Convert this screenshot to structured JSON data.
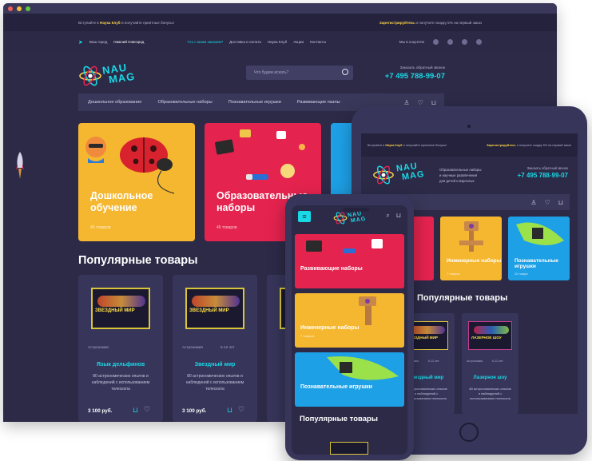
{
  "desktop": {
    "window_dots": [
      "#ee5d52",
      "#f5be33",
      "#5fc83d"
    ],
    "top_strip": {
      "left_prefix": "Вступайте в",
      "left_link": "Наука Клуб",
      "left_suffix": "и получайте приятные бонусы!",
      "right_link": "Зарегистрируйтесь",
      "right_suffix": "и получите скидку 5% на первый заказ"
    },
    "nav": {
      "city_label": "Ваш город",
      "city": "Нижний Новгород",
      "items": [
        "Что с моим заказом?",
        "Доставка и оплата",
        "Наука Клуб",
        "Акции",
        "Контакты"
      ],
      "social_label": "Мы в соцсетях"
    },
    "logo": {
      "line1": "NAU",
      "line2": "MAG"
    },
    "search_placeholder": "Что будем искать?",
    "callback_label": "Заказать обратный звонок",
    "phone": "+7 495 788-99-07",
    "menu": [
      "Дошкольное образование",
      "Образовательные наборы",
      "Познавательные игрушки",
      "Развивающие пазлы"
    ],
    "categories": [
      {
        "name": "Дошкольное обучение",
        "count": "45 товаров",
        "color": "#f5b730"
      },
      {
        "name": "Образовательные наборы",
        "count": "45 товаров",
        "color": "#e5234f"
      },
      {
        "name": "",
        "count": "",
        "color": "#1ea0e6"
      }
    ],
    "section_title": "Популярные товары",
    "products": [
      {
        "category": "Астрономия",
        "age": "",
        "name": "Язык дельфинов",
        "desc": "80 астрономических опытов и наблюдений с использованием телескопа",
        "price": "3 100 руб.",
        "image_text": "ЗВЕЗДНЫЙ МИР"
      },
      {
        "category": "Астрономия",
        "age": "6-12 лет",
        "name": "Звездный мир",
        "desc": "80 астрономических опытов и наблюдений с использованием телескопа",
        "price": "3 100 руб.",
        "image_text": "ЗВЕЗДНЫЙ МИР"
      },
      {
        "category": "",
        "age": "",
        "name": "",
        "desc": "",
        "price": "",
        "image_text": ""
      }
    ]
  },
  "tablet": {
    "top_strip": {
      "left_prefix": "Вступайте в",
      "left_link": "Наука Клуб",
      "left_suffix": "и получайте приятные бонусы!",
      "right_link": "Зарегистрируйтесь",
      "right_suffix": "и получите скидку 5% на первый заказ"
    },
    "tagline": [
      "Образовательные наборы",
      "и научные развлечения",
      "для детей и взрослых"
    ],
    "callback_label": "Заказать обратный звонок",
    "phone": "+7 495 788-99-07",
    "categories": [
      {
        "name": "",
        "count": "",
        "color": "#e5234f"
      },
      {
        "name": "Инженерные наборы",
        "count": "7 товаров",
        "color": "#f5b730"
      },
      {
        "name": "Познавательные игрушки",
        "count": "32 товара",
        "color": "#1ea0e6"
      }
    ],
    "section_title": "Популярные товары",
    "products": [
      {
        "category": "Астрономия",
        "age": "6-12 лет",
        "name": "Звездный мир",
        "desc": "80 астрономических опытов и наблюдений с использованием телескопа",
        "image_text": "ЗВЕЗДНЫЙ МИР"
      },
      {
        "category": "Астрономия",
        "age": "6-12 лет",
        "name": "Лазерное шоу",
        "desc": "80 астрономических опытов и наблюдений с использованием телескопа",
        "image_text": "ЛАЗЕРНОЕ ШОУ"
      }
    ]
  },
  "phone": {
    "logo": {
      "line1": "NAU",
      "line2": "MAG"
    },
    "categories": [
      {
        "name": "Развивающие наборы",
        "count": "",
        "color": "#e5234f"
      },
      {
        "name": "Инженерные наборы",
        "count": "7 товаров",
        "color": "#f5b730"
      },
      {
        "name": "Познавательные игрушки",
        "count": "",
        "color": "#1ea0e6"
      }
    ],
    "section_title": "Популярные товары"
  }
}
